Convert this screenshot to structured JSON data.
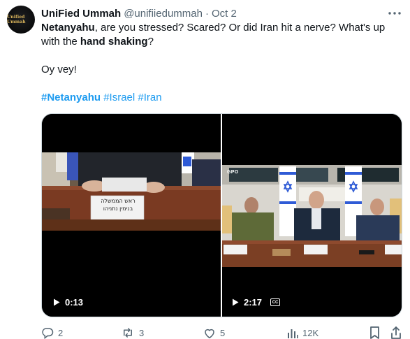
{
  "author": {
    "display_name": "UniFied Ummah",
    "handle": "@unifiiedummah",
    "separator": "·",
    "date": "Oct 2",
    "avatar_text": "Unified Ummah"
  },
  "tweet": {
    "line1_bold": "Netanyahu",
    "line1_rest": ", are you stressed? Scared? Or did Iran hit a nerve? What's up",
    "line2_pre": "with the ",
    "line2_bold": "hand shaking",
    "line2_post": "?",
    "line3": "Oy vey!",
    "hashtags": [
      "#Netanyahu",
      "#Israel",
      "#Iran"
    ]
  },
  "media": {
    "left": {
      "duration": "0:13",
      "placard_line1": "ראש הממשלה",
      "placard_line2": "בנימין נתניהו"
    },
    "right": {
      "duration": "2:17",
      "cc_label": "CC",
      "gpo_label": "GPO"
    }
  },
  "actions": {
    "replies": "2",
    "reposts": "3",
    "likes": "5",
    "views": "12K"
  },
  "colors": {
    "accent": "#1d9bf0",
    "muted": "#536471",
    "text": "#0f1419",
    "border": "#cfd9de"
  },
  "icons": [
    "more-icon",
    "play-icon",
    "cc-icon",
    "reply-icon",
    "repost-icon",
    "like-icon",
    "views-icon",
    "bookmark-icon",
    "share-icon"
  ]
}
